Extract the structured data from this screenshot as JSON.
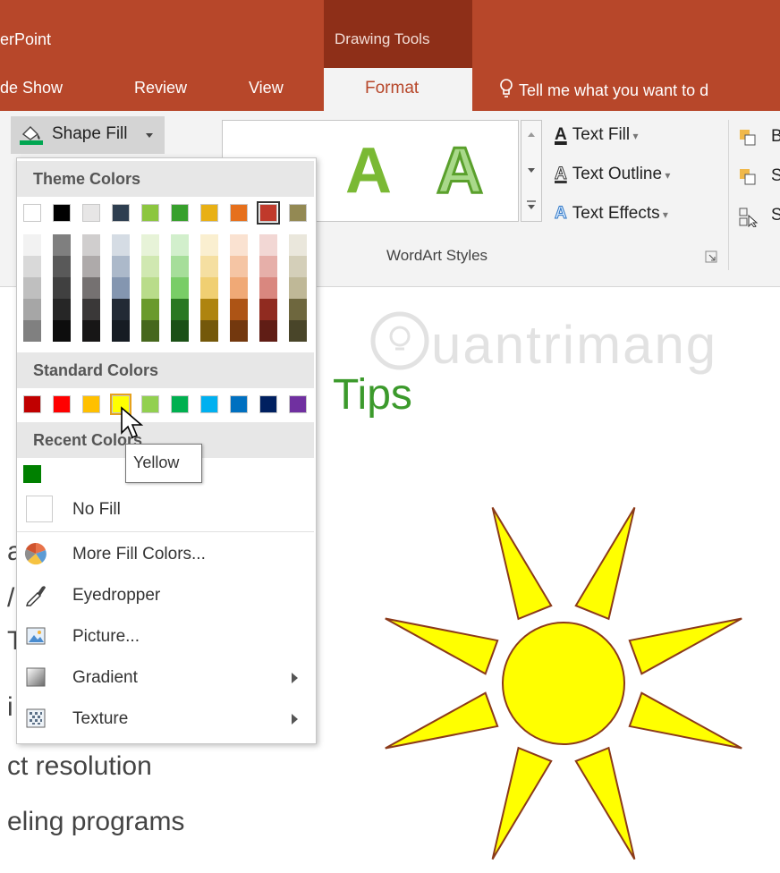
{
  "app": {
    "title": "erPoint"
  },
  "context_group": {
    "title": "Drawing Tools"
  },
  "tabs": [
    {
      "label": "de Show"
    },
    {
      "label": "Review"
    },
    {
      "label": "View"
    },
    {
      "label": "Format"
    }
  ],
  "tell_me": {
    "text": "Tell me what you want to d"
  },
  "ribbon": {
    "shape_fill_label": "Shape Fill",
    "wordart": {
      "letter": "A",
      "text_fill": "Text Fill",
      "text_outline": "Text Outline",
      "text_effects": "Text Effects",
      "group_label": "WordArt Styles"
    },
    "arrange_partial": [
      "B",
      "S",
      "S"
    ]
  },
  "dropdown": {
    "theme_header": "Theme Colors",
    "standard_header": "Standard Colors",
    "recent_header": "Recent Colors",
    "no_fill": "No Fill",
    "more_fill": "More Fill Colors...",
    "eyedropper": "Eyedropper",
    "picture": "Picture...",
    "gradient": "Gradient",
    "texture": "Texture",
    "theme_colors": [
      "#ffffff",
      "#000000",
      "#e7e6e6",
      "#2e3e50",
      "#8cc63f",
      "#37a02c",
      "#e8b014",
      "#e6701c",
      "#c0392b",
      "#938953"
    ],
    "theme_shades": [
      [
        "#f2f2f2",
        "#d9d9d9",
        "#bfbfbf",
        "#a6a6a6",
        "#808080"
      ],
      [
        "#7f7f7f",
        "#595959",
        "#404040",
        "#262626",
        "#0d0d0d"
      ],
      [
        "#d0cece",
        "#aeaaaa",
        "#757171",
        "#3a3838",
        "#171616"
      ],
      [
        "#d5dce4",
        "#acb9ca",
        "#8496b0",
        "#222a35",
        "#161c23"
      ],
      [
        "#e7f3d8",
        "#d0e8b1",
        "#b9dc8a",
        "#6a9a2c",
        "#46671d"
      ],
      [
        "#d2efcc",
        "#a6de9a",
        "#79cd67",
        "#297821",
        "#1b5016"
      ],
      [
        "#faefd0",
        "#f5dfa1",
        "#f0cf72",
        "#ae840f",
        "#74580a"
      ],
      [
        "#fae2d1",
        "#f5c5a4",
        "#f0a976",
        "#ad5415",
        "#73380e"
      ],
      [
        "#f2d7d4",
        "#e6afa9",
        "#d9877f",
        "#902b20",
        "#601d15"
      ],
      [
        "#eae7dc",
        "#d4cfb9",
        "#bfb897",
        "#6e673e",
        "#494529"
      ]
    ],
    "standard_colors": [
      "#c00000",
      "#ff0000",
      "#ffc000",
      "#ffff00",
      "#92d050",
      "#00b050",
      "#00b0f0",
      "#0070c0",
      "#002060",
      "#7030a0"
    ],
    "recent_colors": [
      "#008000"
    ]
  },
  "tooltip": {
    "text": "Yellow"
  },
  "slide": {
    "title": "Tips",
    "watermark": "uantrimang",
    "lines": [
      "a",
      "/",
      "T",
      "i",
      "ct resolution",
      "eling programs"
    ],
    "sun_fill": "#ffff00",
    "sun_stroke": "#8b3a1a"
  }
}
